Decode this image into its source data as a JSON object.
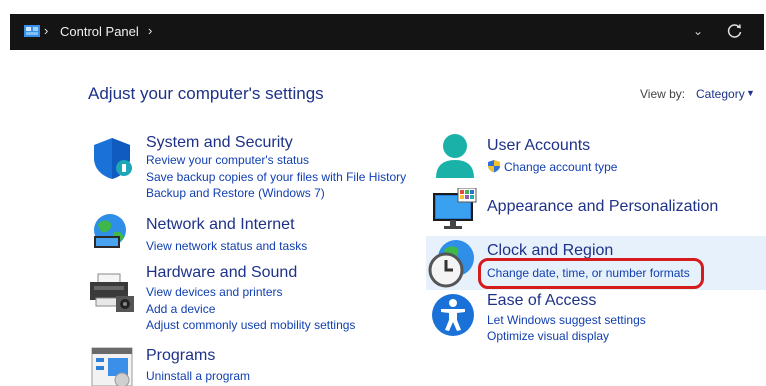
{
  "address_bar": {
    "breadcrumb": "Control Panel",
    "colors": {
      "background": "#141414",
      "text": "#f0f0f0"
    },
    "icons": [
      "control-panel-icon",
      "chevron-right-icon",
      "chevron-down-icon",
      "refresh-icon"
    ]
  },
  "header": {
    "title": "Adjust your computer's settings",
    "view_by_label": "View by:",
    "view_by_value": "Category"
  },
  "categories_left": [
    {
      "title": "System and Security",
      "icon": "shield-icon",
      "links": [
        "Review your computer's status",
        "Save backup copies of your files with File History",
        "Backup and Restore (Windows 7)"
      ]
    },
    {
      "title": "Network and Internet",
      "icon": "network-globe-icon",
      "links": [
        "View network status and tasks"
      ]
    },
    {
      "title": "Hardware and Sound",
      "icon": "printer-icon",
      "links": [
        "View devices and printers",
        "Add a device",
        "Adjust commonly used mobility settings"
      ]
    },
    {
      "title": "Programs",
      "icon": "programs-icon",
      "links": [
        "Uninstall a program"
      ]
    }
  ],
  "categories_right": [
    {
      "title": "User Accounts",
      "icon": "user-icon",
      "links": [
        "Change account type"
      ]
    },
    {
      "title": "Appearance and Personalization",
      "icon": "monitor-icon",
      "links": []
    },
    {
      "title": "Clock and Region",
      "icon": "clock-globe-icon",
      "links": [
        "Change date, time, or number formats"
      ]
    },
    {
      "title": "Ease of Access",
      "icon": "accessibility-icon",
      "links": [
        "Let Windows suggest settings",
        "Optimize visual display"
      ]
    }
  ],
  "colors": {
    "title": "#1e3287",
    "link": "#1240b0",
    "highlight_row": "#e6f1fb",
    "annotation": "#d41c1c"
  }
}
